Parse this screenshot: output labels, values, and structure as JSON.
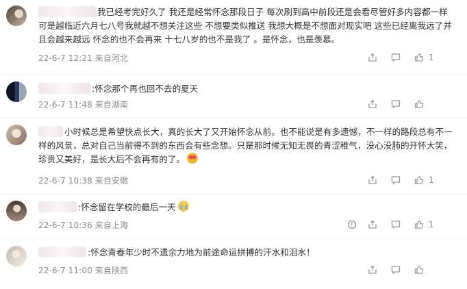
{
  "comments": [
    {
      "text": "我已经考完好久了 我还是经常怀念那段日子 每次刷到高中前段还是会看尽管好多内容都一样 可是越临近六月七八号我就越不想关注这些 不想要类似推送 我想大概是不想面对现实吧 这些已经离我远了并且会越来越远 怀念的也不会再来 十七八岁的也不是我了 。是怀念，也是羡慕。",
      "date": "22-6-7",
      "time": "12:21",
      "location": "来自河北",
      "likes": "1"
    },
    {
      "text": ":怀念那个再也回不去的夏天",
      "date": "22-6-7",
      "time": "11:48",
      "location": "来自湖南",
      "likes": ""
    },
    {
      "text": "小时候总是希望快点长大，真的长大了又开始怀念从前。也不能说是有多遗憾，不一样的路段总有不一样的风景，总对自己当前得不到的东西会有些念想。只是那时候无知无畏的青涩稚气，没心没肺的开怀大笑，珍贵又美好，是长大后不会再有的了。",
      "date": "22-6-7",
      "time": "10:38",
      "location": "来自安徽",
      "likes": "1"
    },
    {
      "text": ":怀念留在学校的最后一天",
      "date": "22-6-7",
      "time": "10:36",
      "location": "来自上海",
      "likes": "1"
    },
    {
      "text": ":怀念青春年少时不遗余力地为前途命运拼搏的汗水和泪水！",
      "date": "22-6-7",
      "time": "11:00",
      "location": "来自陕西",
      "likes": ""
    }
  ],
  "icons": {
    "share": "share-icon",
    "comment": "comment-icon",
    "like": "thumbs-up-icon",
    "report": "report-icon"
  },
  "colors": {
    "text": "#333333",
    "meta": "#8a8a8a",
    "icon": "#9a9a9a",
    "divider": "#efefef"
  }
}
